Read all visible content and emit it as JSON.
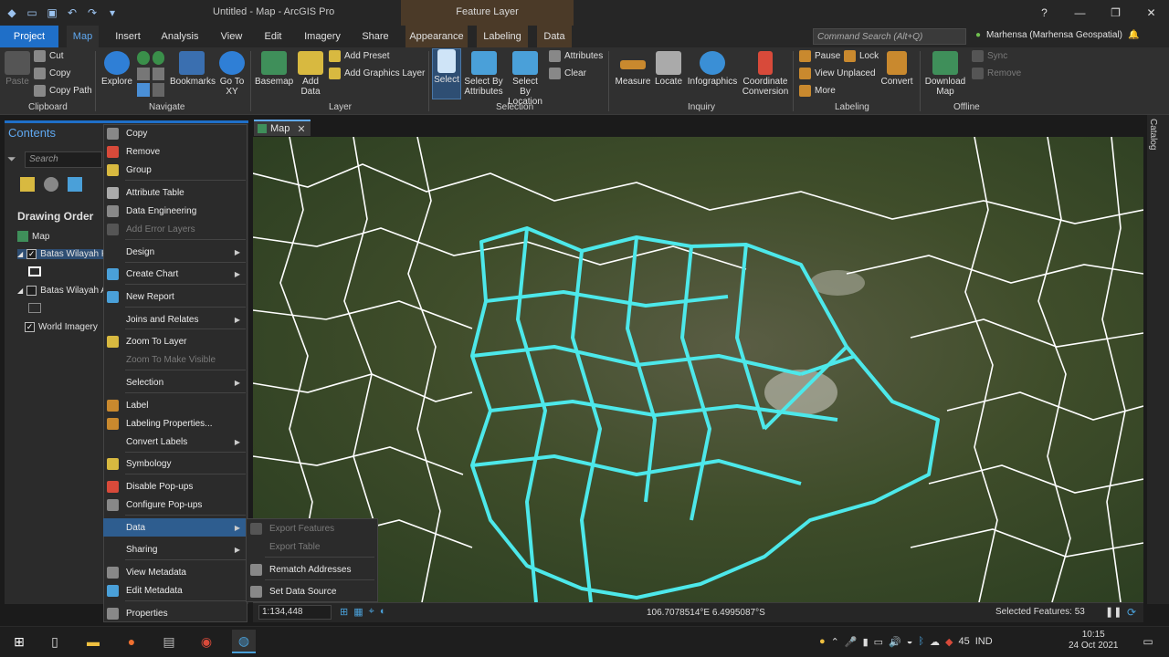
{
  "window": {
    "title": "Untitled - Map - ArcGIS Pro",
    "context_group": "Feature Layer"
  },
  "tabs": [
    "Project",
    "Map",
    "Insert",
    "Analysis",
    "View",
    "Edit",
    "Imagery",
    "Share",
    "Appearance",
    "Labeling",
    "Data"
  ],
  "command_search": {
    "placeholder": "Command Search (Alt+Q)"
  },
  "user": "Marhensa (Marhensa Geospatial)",
  "ribbon": {
    "clipboard": {
      "label": "Clipboard",
      "paste": "Paste",
      "cut": "Cut",
      "copy": "Copy",
      "copy_path": "Copy Path"
    },
    "navigate": {
      "label": "Navigate",
      "explore": "Explore",
      "bookmarks": "Bookmarks",
      "go_to_xy": "Go To XY"
    },
    "layer": {
      "label": "Layer",
      "basemap": "Basemap",
      "add_data": "Add Data",
      "add_preset": "Add Preset",
      "add_graphics_layer": "Add Graphics Layer"
    },
    "selection": {
      "label": "Selection",
      "select": "Select",
      "select_by_attributes": "Select By Attributes",
      "select_by_location": "Select By Location",
      "attributes": "Attributes",
      "clear": "Clear"
    },
    "inquiry": {
      "label": "Inquiry",
      "measure": "Measure",
      "locate": "Locate",
      "infographics": "Infographics",
      "coordinate_conversion": "Coordinate Conversion"
    },
    "labeling": {
      "label": "Labeling",
      "pause": "Pause",
      "lock": "Lock",
      "view_unplaced": "View Unplaced",
      "more": "More",
      "convert": "Convert"
    },
    "offline": {
      "label": "Offline",
      "download_map": "Download Map",
      "sync": "Sync",
      "remove": "Remove"
    }
  },
  "contents": {
    "title": "Contents",
    "search_placeholder": "Search",
    "drawing_order": "Drawing Order",
    "layers": [
      {
        "name": "Map"
      },
      {
        "name": "Batas Wilayah K",
        "checked": true
      },
      {
        "name": "Batas Wilayah A",
        "checked": false
      },
      {
        "name": "World Imagery",
        "checked": true
      }
    ]
  },
  "map_tab": "Map",
  "catalog": "Catalog",
  "context_menu": [
    {
      "label": "Copy",
      "icon": "copy-icon"
    },
    {
      "label": "Remove",
      "icon": "remove-icon"
    },
    {
      "label": "Group",
      "icon": "group-icon"
    },
    {
      "label": "Attribute Table",
      "icon": "table-icon"
    },
    {
      "label": "Data Engineering",
      "icon": "data-engineering-icon"
    },
    {
      "label": "Add Error Layers",
      "icon": "error-layers-icon",
      "disabled": true
    },
    {
      "label": "Design",
      "submenu": true
    },
    {
      "label": "Create Chart",
      "icon": "chart-icon",
      "submenu": true
    },
    {
      "label": "New Report",
      "icon": "report-icon"
    },
    {
      "label": "Joins and Relates",
      "submenu": true
    },
    {
      "label": "Zoom To Layer",
      "icon": "zoom-layer-icon"
    },
    {
      "label": "Zoom To Make Visible",
      "disabled": true
    },
    {
      "label": "Selection",
      "submenu": true
    },
    {
      "label": "Label",
      "icon": "label-icon"
    },
    {
      "label": "Labeling Properties...",
      "icon": "labeling-properties-icon"
    },
    {
      "label": "Convert Labels",
      "submenu": true
    },
    {
      "label": "Symbology",
      "icon": "symbology-icon"
    },
    {
      "label": "Disable Pop-ups",
      "icon": "popup-icon"
    },
    {
      "label": "Configure Pop-ups",
      "icon": "configure-popup-icon"
    },
    {
      "label": "Data",
      "submenu": true
    },
    {
      "label": "Sharing",
      "submenu": true
    },
    {
      "label": "View Metadata",
      "icon": "metadata-icon"
    },
    {
      "label": "Edit Metadata",
      "icon": "edit-metadata-icon"
    },
    {
      "label": "Properties",
      "icon": "properties-icon"
    }
  ],
  "data_submenu": [
    {
      "label": "Export Features",
      "disabled": true
    },
    {
      "label": "Export Table",
      "disabled": true
    },
    {
      "label": "Rematch Addresses"
    },
    {
      "label": "Set Data Source"
    }
  ],
  "status": {
    "scale": "1:134,448",
    "coordinates": "106.7078514°E 6.4995087°S",
    "selected_features": "Selected Features: 53"
  },
  "taskbar": {
    "battery": "45",
    "language": "IND",
    "time": "10:15",
    "date": "24 Oct 2021"
  },
  "colors": {
    "accent": "#1f6fc8",
    "selection": "#4de8ea",
    "boundary": "#ffffff"
  }
}
